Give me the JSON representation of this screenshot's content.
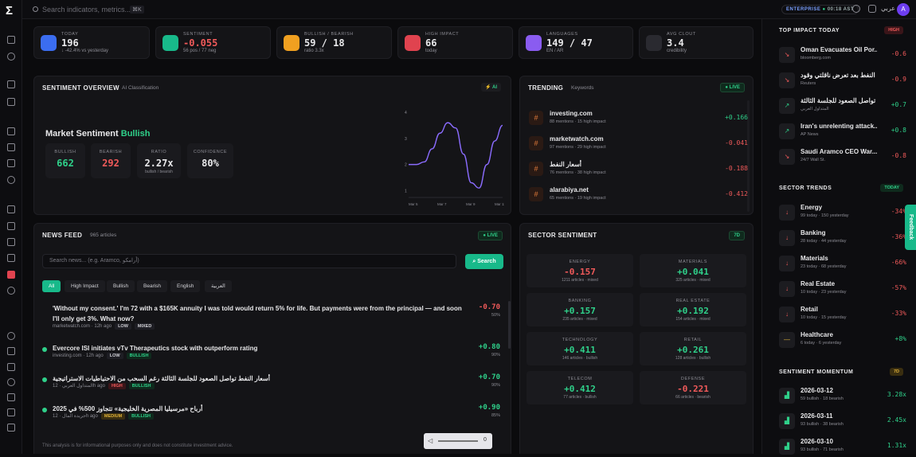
{
  "app": {
    "logo": "Σ"
  },
  "topbar": {
    "search_placeholder": "Search indicators, metrics...",
    "shortcut": "⌘K",
    "plan": "ENTERPRISE",
    "clock": "00:18 AST",
    "lang": "عربي",
    "avatar": "A"
  },
  "kpis": [
    {
      "label": "TODAY",
      "value": "196",
      "sub": "↓ -42.4% vs yesterday",
      "color": "#3b6df0"
    },
    {
      "label": "SENTIMENT",
      "value": "-0.055",
      "sub": "56 pos / 77 neg",
      "color": "#18b98a"
    },
    {
      "label": "BULLISH / BEARISH",
      "value": "59 / 18",
      "sub": "ratio 3.3x",
      "color": "#f0a020"
    },
    {
      "label": "HIGH IMPACT",
      "value": "66",
      "sub": "today",
      "color": "#e0434f"
    },
    {
      "label": "LANGUAGES",
      "value": "149 / 47",
      "sub": "EN / AR",
      "color": "#8a5cf0"
    },
    {
      "label": "AVG CLOUT",
      "value": "3.4",
      "sub": "credibility",
      "color": "#2a2a30"
    }
  ],
  "overview": {
    "title": "SENTIMENT OVERVIEW",
    "tab": "AI Classification",
    "badge": "AI",
    "heading": "Market Sentiment",
    "mood": "Bullish",
    "stats": [
      {
        "k": "BULLISH",
        "v": "662"
      },
      {
        "k": "BEARISH",
        "v": "292"
      },
      {
        "k": "RATIO",
        "v": "2.27x",
        "s": "bullish / bearish"
      },
      {
        "k": "CONFIDENCE",
        "v": "80%"
      }
    ]
  },
  "chart_data": {
    "type": "line",
    "x": [
      "Mar 5",
      "Mar 7",
      "Mar 9",
      "Mar 11"
    ],
    "y_ticks": [
      "4",
      "3",
      "2",
      "1"
    ],
    "series": [
      {
        "values": [
          2,
          2,
          2.1,
          2.6,
          3.2,
          3.6,
          3.4,
          2.4,
          1.3,
          1.1,
          2.0,
          2.9,
          3.5
        ]
      }
    ],
    "ylim": [
      0.8,
      4
    ]
  },
  "trending": {
    "title": "TRENDING",
    "tab": "Keywords",
    "badge": "LIVE",
    "items": [
      {
        "name": "investing.com",
        "meta": "88 mentions · 15 high impact",
        "score": "+0.166"
      },
      {
        "name": "marketwatch.com",
        "meta": "97 mentions · 29 high impact",
        "score": "-0.041"
      },
      {
        "name": "أسعار النفط",
        "meta": "76 mentions · 38 high impact",
        "score": "-0.188"
      },
      {
        "name": "alarabiya.net",
        "meta": "65 mentions · 19 high impact",
        "score": "-0.412"
      }
    ]
  },
  "news": {
    "title": "NEWS FEED",
    "count": "965 articles",
    "badge": "LIVE",
    "placeholder": "Search news... (e.g. Aramco, أرامكو)",
    "search_label": "Search",
    "chips": [
      "All",
      "High Impact",
      "Bullish",
      "Bearish",
      "English",
      "العربية"
    ],
    "items": [
      {
        "title": "'Without my consent.' I'm 72 with a $165K annuity I was told would return 5% for life. But payments were from the principal — and soon I'll only get 3%. What now?",
        "source": "marketwatch.com",
        "time": "12h ago",
        "tags": [
          "LOW",
          "MIXED"
        ],
        "score": "-0.70",
        "conf": "50%"
      },
      {
        "title": "Evercore ISI initiates vTv Therapeutics stock with outperform rating",
        "source": "investing.com",
        "time": "12h ago",
        "tags": [
          "LOW",
          "BULLISH"
        ],
        "score": "+0.80",
        "conf": "90%"
      },
      {
        "title": "أسعار النفط تواصل الصعود للجلسة الثالثة رغم السحب من الاحتياطيات الاستراتيجية",
        "source": "المتداول العربي",
        "time": "12h ago",
        "tags": [
          "HIGH",
          "BULLISH"
        ],
        "score": "+0.70",
        "conf": "90%"
      },
      {
        "title": "أرباح «مرسيليا المصرية الخليجية» تتجاوز 500% في 2025",
        "source": "جريدة المال",
        "time": "12h ago",
        "tags": [
          "MEDIUM",
          "BULLISH"
        ],
        "score": "+0.90",
        "conf": "85%"
      }
    ],
    "disclaimer": "This analysis is for informational purposes only and does not constitute investment advice."
  },
  "sector": {
    "title": "SECTOR SENTIMENT",
    "badge": "7D",
    "items": [
      {
        "k": "ENERGY",
        "v": "-0.157",
        "m": "1211 articles · mixed"
      },
      {
        "k": "MATERIALS",
        "v": "+0.041",
        "m": "325 articles · mixed"
      },
      {
        "k": "BANKING",
        "v": "+0.157",
        "m": "235 articles · mixed"
      },
      {
        "k": "REAL ESTATE",
        "v": "+0.192",
        "m": "154 articles · mixed"
      },
      {
        "k": "TECHNOLOGY",
        "v": "+0.411",
        "m": "146 articles · bullish"
      },
      {
        "k": "RETAIL",
        "v": "+0.261",
        "m": "128 articles · bullish"
      },
      {
        "k": "TELECOM",
        "v": "+0.412",
        "m": "77 articles · bullish"
      },
      {
        "k": "DEFENSE",
        "v": "-0.221",
        "m": "66 articles · bearish"
      }
    ]
  },
  "side": {
    "impact": {
      "title": "TOP IMPACT TODAY",
      "badge": "HIGH",
      "items": [
        {
          "name": "Oman Evacuates Oil Por...",
          "meta": "bloomberg.com",
          "score": "-0.6"
        },
        {
          "name": "النفط بعد تعرض ناقلتي وقود",
          "meta": "Reuters",
          "score": "-0.9"
        },
        {
          "name": "تواصل الصعود للجلسة الثالثة",
          "meta": "المتداول العربي",
          "score": "+0.7"
        },
        {
          "name": "Iran's unrelenting attack...",
          "meta": "AP News",
          "score": "+0.8"
        },
        {
          "name": "Saudi Aramco CEO War...",
          "meta": "24/7 Wall St.",
          "score": "-0.8"
        }
      ]
    },
    "trends": {
      "title": "SECTOR TRENDS",
      "badge": "TODAY",
      "items": [
        {
          "name": "Energy",
          "meta": "99 today · 150 yesterday",
          "score": "-34%"
        },
        {
          "name": "Banking",
          "meta": "28 today · 44 yesterday",
          "score": "-36%"
        },
        {
          "name": "Materials",
          "meta": "23 today · 68 yesterday",
          "score": "-66%"
        },
        {
          "name": "Real Estate",
          "meta": "10 today · 23 yesterday",
          "score": "-57%"
        },
        {
          "name": "Retail",
          "meta": "10 today · 15 yesterday",
          "score": "-33%"
        },
        {
          "name": "Healthcare",
          "meta": "6 today · 6 yesterday",
          "score": "+8%"
        }
      ]
    },
    "momentum": {
      "title": "SENTIMENT MOMENTUM",
      "badge": "7D",
      "items": [
        {
          "name": "2026-03-12",
          "meta": "59 bullish · 18 bearish",
          "score": "3.28x"
        },
        {
          "name": "2026-03-11",
          "meta": "93 bullish · 38 bearish",
          "score": "2.45x"
        },
        {
          "name": "2026-03-10",
          "meta": "93 bullish · 71 bearish",
          "score": "1.31x"
        }
      ]
    },
    "feedback": "Feedback"
  },
  "player": {
    "time": "0"
  }
}
